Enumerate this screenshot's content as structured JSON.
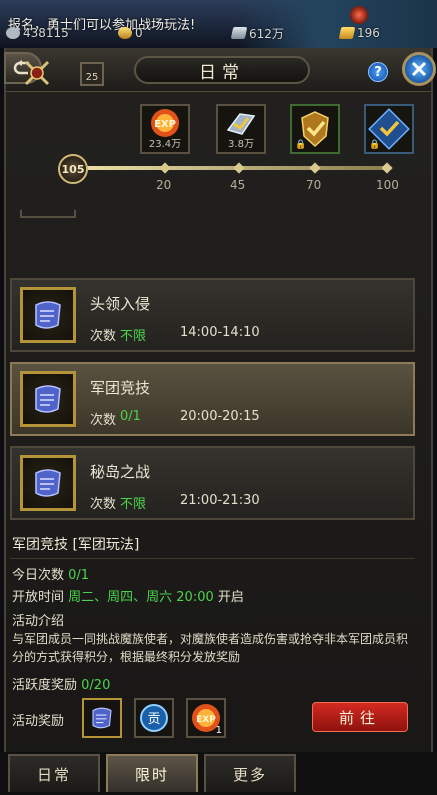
{
  "status_bar": {
    "notice": "报名，勇士们可以参加战场玩法!",
    "resources": [
      {
        "icon": "power-icon",
        "value": "438115"
      },
      {
        "icon": "gold-coin-icon",
        "value": "0"
      },
      {
        "icon": "silver-icon",
        "value": "612万"
      },
      {
        "icon": "gold-ingot-icon",
        "value": "196"
      }
    ]
  },
  "window": {
    "title": "日常",
    "help_label": "?"
  },
  "activity": {
    "calendar_day": "25",
    "current_level": "105",
    "milestones": [
      {
        "points": "20",
        "reward_icon": "exp-icon",
        "amount": "23.4万",
        "locked": false
      },
      {
        "points": "45",
        "reward_icon": "silver-icon",
        "amount": "3.8万",
        "locked": false
      },
      {
        "points": "70",
        "reward_icon": "gold-shield-icon",
        "amount": "",
        "locked": true
      },
      {
        "points": "100",
        "reward_icon": "blue-shield-icon",
        "amount": "",
        "locked": true
      }
    ]
  },
  "events": [
    {
      "name": "头领入侵",
      "count_label": "次数",
      "count": "不限",
      "time": "14:00-14:10",
      "selected": false
    },
    {
      "name": "军团竞技",
      "count_label": "次数",
      "count": "0/1",
      "time": "20:00-20:15",
      "selected": true
    },
    {
      "name": "秘岛之战",
      "count_label": "次数",
      "count": "不限",
      "time": "21:00-21:30",
      "selected": false
    }
  ],
  "details": {
    "title": "军团竞技 [军团玩法]",
    "today_label": "今日次数",
    "today_value": "0/1",
    "open_label": "开放时间",
    "open_days": "周二、周四、周六 20:00",
    "open_suffix": "开启",
    "intro_label": "活动介绍",
    "intro_text": "与军团成员一同挑战魔族使者，对魔族使者造成伤害或抢夺非本军团成员积分的方式获得积分，根据最终积分发放奖励",
    "activeness_label": "活跃度奖励",
    "activeness_value": "0/20",
    "rewards_label": "活动奖励",
    "reward_items": [
      {
        "icon": "scroll-icon",
        "count": ""
      },
      {
        "icon": "contribution-icon",
        "label": "贡",
        "count": ""
      },
      {
        "icon": "exp-icon",
        "label": "EXP",
        "count": "1"
      }
    ],
    "go_button": "前往"
  },
  "tabs": [
    {
      "label": "日常",
      "active": false
    },
    {
      "label": "限时",
      "active": true
    },
    {
      "label": "更多",
      "active": false
    }
  ]
}
